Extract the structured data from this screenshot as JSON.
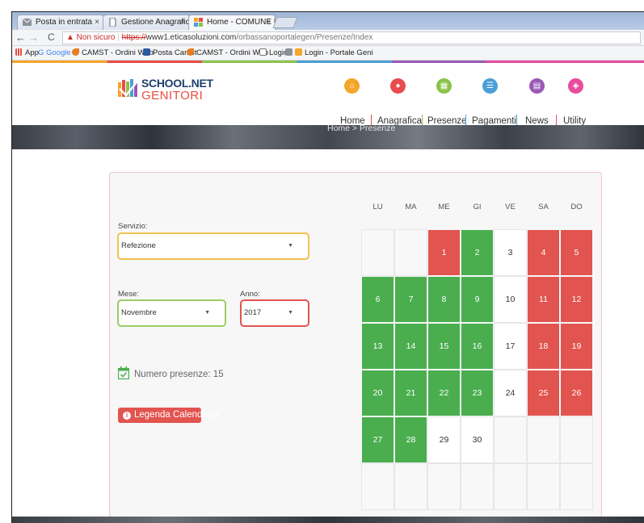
{
  "browser": {
    "tabs": [
      {
        "label": "Posta in entrata",
        "close": "×",
        "favicon_color": "#8a8f99"
      },
      {
        "label": "Gestione Anagrafiche",
        "close": "×",
        "favicon_color": "#ffffff"
      },
      {
        "label": "Home - COMUNE DI OR",
        "close": "×",
        "favicon_color": "#f4a62a"
      }
    ],
    "nav": {
      "back": "←",
      "forward": "→",
      "reload": "C"
    },
    "address": {
      "warning": "▲ Non sicuro",
      "scheme": "https://",
      "host": "www1.eticasoluzioni.com",
      "path": "/orbassanoportalegen/Presenze/Index"
    },
    "bookmarks": [
      {
        "label": "App",
        "color": "#e84c3d"
      },
      {
        "label": "G  Google",
        "color": ""
      },
      {
        "label": "CAMST - Ordini Web",
        "color": "#e67e22"
      },
      {
        "label": "Posta Camst",
        "color": "#2c5aa0"
      },
      {
        "label": "CAMST - Ordini Web",
        "color": "#e67e22"
      },
      {
        "label": "Login",
        "color": "#ffffff"
      },
      {
        "label": "Login - Portale Geni",
        "color": "#f4a62a"
      }
    ]
  },
  "site": {
    "logo": {
      "line1": "SCHOOL.NET",
      "line2": "GENITORI"
    },
    "nav": [
      {
        "label": "Home",
        "color": "#f4a62a",
        "glyph": "⌂"
      },
      {
        "label": "Anagrafica",
        "color": "#e84c4c",
        "glyph": "●"
      },
      {
        "label": "Presenze",
        "color": "#8bc34a",
        "glyph": "▦"
      },
      {
        "label": "Pagamenti",
        "color": "#4a9fd8",
        "glyph": "☰"
      },
      {
        "label": "News",
        "color": "#9b59b6",
        "glyph": "▤"
      },
      {
        "label": "Utility",
        "color": "#e84c9e",
        "glyph": "◈"
      }
    ],
    "breadcrumb": "Home  >  Presenze"
  },
  "form": {
    "servizio_label": "Servizio:",
    "servizio_value": "Refezione",
    "mese_label": "Mese:",
    "mese_value": "Novembre",
    "anno_label": "Anno:",
    "anno_value": "2017",
    "caret": "▼",
    "servizio_color": "#f2c14e",
    "mese_color": "#9ccc65",
    "anno_color": "#e2544f"
  },
  "summary": {
    "label": "Numero presenze: 15"
  },
  "legend_button": {
    "label": "Legenda Calendario",
    "info": "i"
  },
  "calendar": {
    "weekdays": [
      "LU",
      "MA",
      "ME",
      "GI",
      "VE",
      "SA",
      "DO"
    ],
    "rows": [
      [
        {
          "d": "",
          "s": "empty"
        },
        {
          "d": "",
          "s": "empty"
        },
        {
          "d": "1",
          "s": "red"
        },
        {
          "d": "2",
          "s": "green"
        },
        {
          "d": "3",
          "s": "white"
        },
        {
          "d": "4",
          "s": "red"
        },
        {
          "d": "5",
          "s": "red"
        }
      ],
      [
        {
          "d": "6",
          "s": "green"
        },
        {
          "d": "7",
          "s": "green"
        },
        {
          "d": "8",
          "s": "green"
        },
        {
          "d": "9",
          "s": "green"
        },
        {
          "d": "10",
          "s": "white"
        },
        {
          "d": "11",
          "s": "red"
        },
        {
          "d": "12",
          "s": "red"
        }
      ],
      [
        {
          "d": "13",
          "s": "green"
        },
        {
          "d": "14",
          "s": "green"
        },
        {
          "d": "15",
          "s": "green"
        },
        {
          "d": "16",
          "s": "green"
        },
        {
          "d": "17",
          "s": "white"
        },
        {
          "d": "18",
          "s": "red"
        },
        {
          "d": "19",
          "s": "red"
        }
      ],
      [
        {
          "d": "20",
          "s": "green"
        },
        {
          "d": "21",
          "s": "green"
        },
        {
          "d": "22",
          "s": "green"
        },
        {
          "d": "23",
          "s": "green"
        },
        {
          "d": "24",
          "s": "white"
        },
        {
          "d": "25",
          "s": "red"
        },
        {
          "d": "26",
          "s": "red"
        }
      ],
      [
        {
          "d": "27",
          "s": "green"
        },
        {
          "d": "28",
          "s": "green"
        },
        {
          "d": "29",
          "s": "white"
        },
        {
          "d": "30",
          "s": "white"
        },
        {
          "d": "",
          "s": "empty"
        },
        {
          "d": "",
          "s": "empty"
        },
        {
          "d": "",
          "s": "empty"
        }
      ],
      [
        {
          "d": "",
          "s": "empty"
        },
        {
          "d": "",
          "s": "empty"
        },
        {
          "d": "",
          "s": "empty"
        },
        {
          "d": "",
          "s": "empty"
        },
        {
          "d": "",
          "s": "empty"
        },
        {
          "d": "",
          "s": "empty"
        },
        {
          "d": "",
          "s": "empty"
        }
      ]
    ]
  }
}
